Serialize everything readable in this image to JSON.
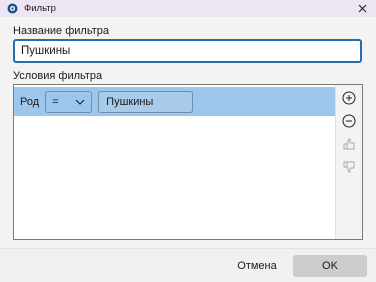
{
  "window": {
    "title": "Фильтр"
  },
  "name_section": {
    "label": "Название фильтра",
    "value": "Пушкины"
  },
  "conditions_section": {
    "label": "Условия фильтра",
    "rows": [
      {
        "field": "Род",
        "operator": "=",
        "value": "Пушкины"
      }
    ]
  },
  "tools": {
    "add": "plus-circle-icon",
    "remove": "minus-circle-icon",
    "move_up": "thumb-up-icon",
    "move_down": "thumb-down-icon"
  },
  "footer": {
    "cancel_label": "Отмена",
    "ok_label": "OK"
  }
}
